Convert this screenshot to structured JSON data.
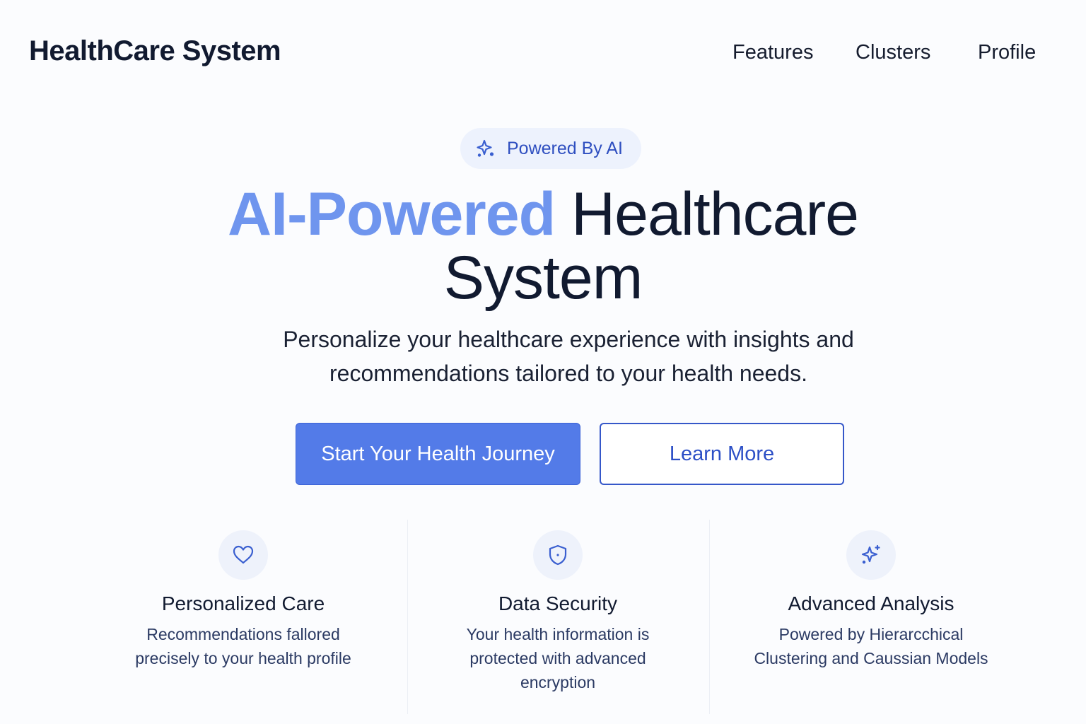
{
  "header": {
    "logo": "HealthCare System",
    "nav": [
      "Features",
      "Clusters",
      "Profile"
    ]
  },
  "hero": {
    "badge": "Powered By AI",
    "title_accent": "AI-Powered",
    "title_rest_line1": "Healthcare",
    "title_line2": "System",
    "subtitle_line1": "Personalize your healthcare experience with insights and",
    "subtitle_line2": "recommendations tailored to your health needs.",
    "primary_button": "Start Your Health Journey",
    "secondary_button": "Learn More"
  },
  "features": [
    {
      "icon": "heart-icon",
      "title": "Personalized Care",
      "desc_line1": "Recommendations fallored",
      "desc_line2": "precisely to your health profile"
    },
    {
      "icon": "shield-icon",
      "title": "Data Security",
      "desc_line1": "Your health information is",
      "desc_line2": "protected with advanced",
      "desc_line3": "encryption"
    },
    {
      "icon": "sparkle-icon",
      "title": "Advanced Analysis",
      "desc_line1": "Powered by Hierarcchical",
      "desc_line2": "Clustering and Caussian Models"
    }
  ],
  "colors": {
    "accent": "#537be8",
    "accent_light": "#6f95ee",
    "text_dark": "#111a30",
    "badge_bg": "#edf2fd"
  }
}
